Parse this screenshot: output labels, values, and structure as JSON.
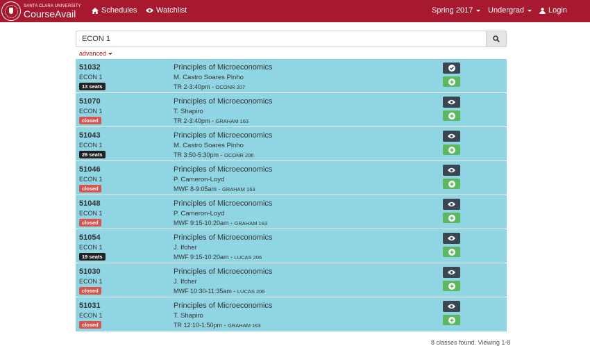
{
  "navbar": {
    "brand_sub": "SANTA CLARA UNIVERSITY",
    "brand_name": "CourseAvail",
    "schedules": "Schedules",
    "watchlist": "Watchlist",
    "term": "Spring 2017",
    "level": "Undergrad",
    "login": "Login",
    "color": "#a6192e"
  },
  "search": {
    "value": "ECON 1",
    "advanced": "advanced"
  },
  "rows": [
    {
      "crn": "51032",
      "course": "ECON 1",
      "status": "13 seats",
      "status_type": "seats",
      "title": "Principles of Microeconomics",
      "instructor": "M. Castro Soares Pinho",
      "time": "TR 2-3:40pm",
      "location": "OCONR 207",
      "view_icon": "check-circle-icon"
    },
    {
      "crn": "51070",
      "course": "ECON 1",
      "status": "closed",
      "status_type": "closed",
      "title": "Principles of Microeconomics",
      "instructor": "T. Shapiro",
      "time": "TR 2-3:40pm",
      "location": "GRAHAM 163",
      "view_icon": "eye-icon"
    },
    {
      "crn": "51043",
      "course": "ECON 1",
      "status": "26 seats",
      "status_type": "seats",
      "title": "Principles of Microeconomics",
      "instructor": "M. Castro Soares Pinho",
      "time": "TR 3:50-5:30pm",
      "location": "OCONR 206",
      "view_icon": "eye-icon"
    },
    {
      "crn": "51046",
      "course": "ECON 1",
      "status": "closed",
      "status_type": "closed",
      "title": "Principles of Microeconomics",
      "instructor": "P. Cameron-Loyd",
      "time": "MWF 8-9:05am",
      "location": "GRAHAM 163",
      "view_icon": "eye-icon"
    },
    {
      "crn": "51048",
      "course": "ECON 1",
      "status": "closed",
      "status_type": "closed",
      "title": "Principles of Microeconomics",
      "instructor": "P. Cameron-Loyd",
      "time": "MWF 9:15-10:20am",
      "location": "GRAHAM 163",
      "view_icon": "eye-icon"
    },
    {
      "crn": "51054",
      "course": "ECON 1",
      "status": "19 seats",
      "status_type": "seats",
      "title": "Principles of Microeconomics",
      "instructor": "J. Ifcher",
      "time": "MWF 9:15-10:20am",
      "location": "LUCAS 206",
      "view_icon": "eye-icon"
    },
    {
      "crn": "51030",
      "course": "ECON 1",
      "status": "closed",
      "status_type": "closed",
      "title": "Principles of Microeconomics",
      "instructor": "J. Ifcher",
      "time": "MWF 10:30-11:35am",
      "location": "LUCAS 206",
      "view_icon": "eye-icon"
    },
    {
      "crn": "51031",
      "course": "ECON 1",
      "status": "closed",
      "status_type": "closed",
      "title": "Principles of Microeconomics",
      "instructor": "T. Shapiro",
      "time": "TR 12:10-1:50pm",
      "location": "GRAHAM 163",
      "view_icon": "eye-icon"
    }
  ],
  "footer": "8 classes found. Viewing 1-8"
}
